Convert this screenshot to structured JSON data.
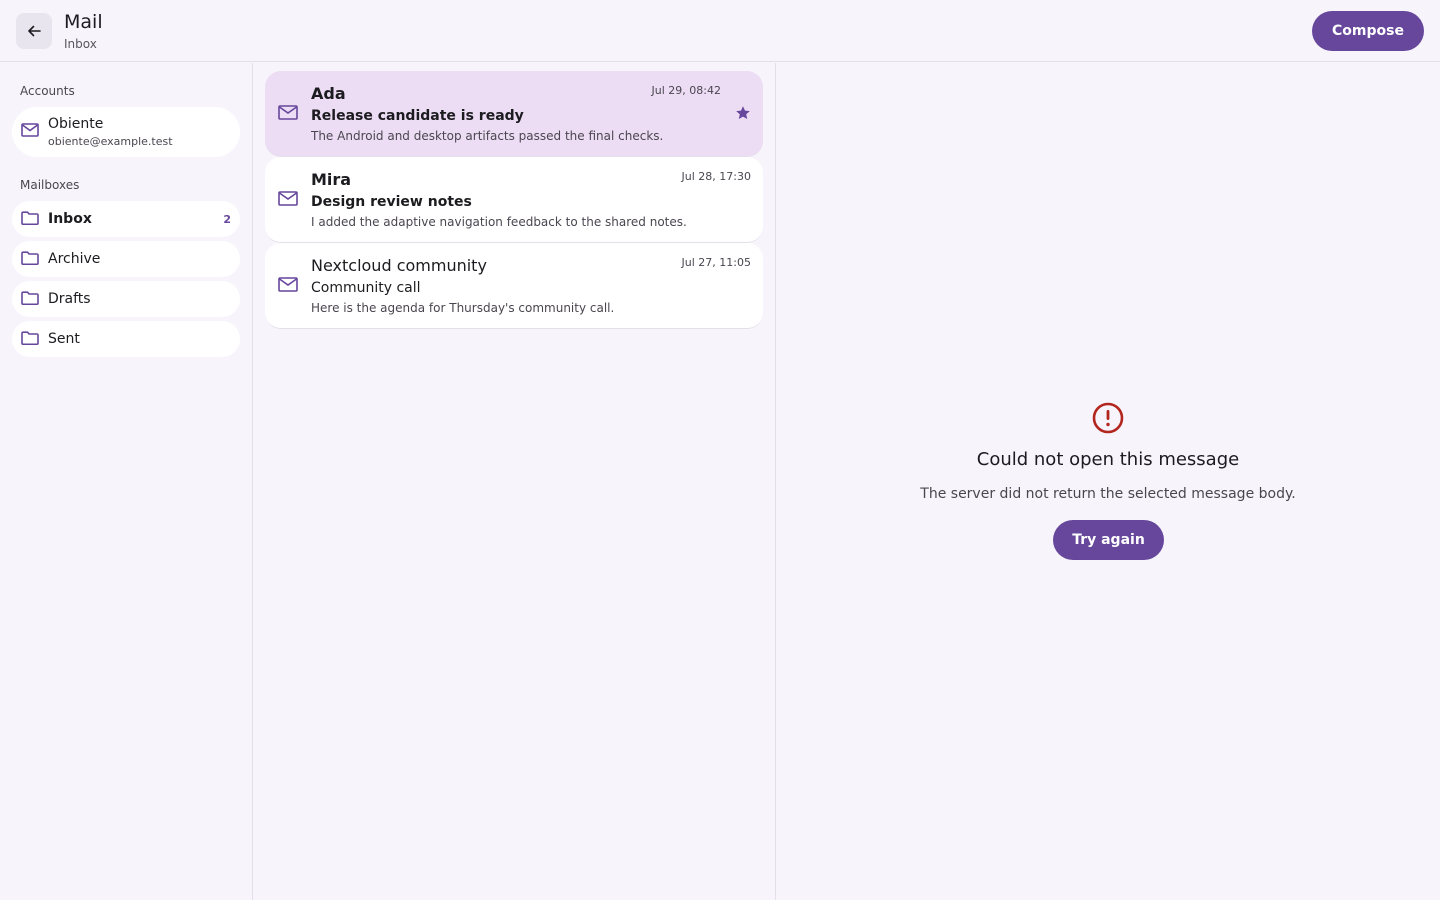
{
  "header": {
    "title": "Mail",
    "subtitle": "Inbox",
    "compose_label": "Compose"
  },
  "sidebar": {
    "accounts_label": "Accounts",
    "account": {
      "name": "Obiente",
      "email": "obiente@example.test",
      "icon": "mail-icon"
    },
    "mailboxes_label": "Mailboxes",
    "mailboxes": [
      {
        "label": "Inbox",
        "count": "2",
        "active": true,
        "icon": "folder-icon"
      },
      {
        "label": "Archive",
        "count": "",
        "active": false,
        "icon": "folder-icon"
      },
      {
        "label": "Drafts",
        "count": "",
        "active": false,
        "icon": "folder-icon"
      },
      {
        "label": "Sent",
        "count": "",
        "active": false,
        "icon": "folder-icon"
      }
    ]
  },
  "messages": [
    {
      "sender": "Ada",
      "subject": "Release candidate is ready",
      "preview": "The Android and desktop artifacts passed the final checks.",
      "time": "Jul 29, 08:42",
      "unread": true,
      "starred": true,
      "selected": true
    },
    {
      "sender": "Mira",
      "subject": "Design review notes",
      "preview": "I added the adaptive navigation feedback to the shared notes.",
      "time": "Jul 28, 17:30",
      "unread": true,
      "starred": false,
      "selected": false
    },
    {
      "sender": "Nextcloud community",
      "subject": "Community call",
      "preview": "Here is the agenda for Thursday's community call.",
      "time": "Jul 27, 11:05",
      "unread": false,
      "starred": false,
      "selected": false
    }
  ],
  "reading_pane": {
    "error_title": "Could not open this message",
    "error_text": "The server did not return the selected message body.",
    "retry_label": "Try again",
    "icon": "error-icon"
  },
  "colors": {
    "accent": "#67479c",
    "selected_bg": "#ecdcf4",
    "error": "#b3261e",
    "background": "#f7f5fb"
  }
}
